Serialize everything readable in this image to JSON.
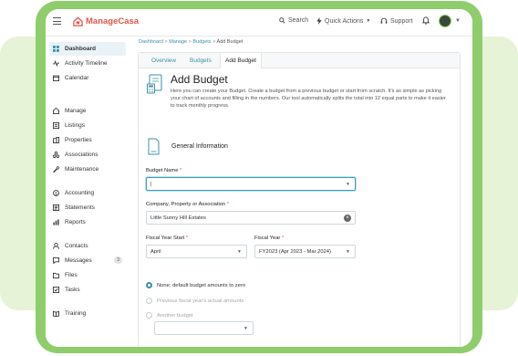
{
  "app": {
    "name": "ManageCasa"
  },
  "topbar": {
    "search_label": "Search",
    "quick_actions_label": "Quick Actions",
    "support_label": "Support"
  },
  "sidebar": {
    "items": [
      {
        "label": "Dashboard",
        "icon": "dashboard-icon",
        "active": true
      },
      {
        "label": "Activity Timeline",
        "icon": "activity-icon"
      },
      {
        "label": "Calendar",
        "icon": "calendar-icon"
      },
      {
        "label": "Manage",
        "icon": "manage-icon"
      },
      {
        "label": "Listings",
        "icon": "listings-icon"
      },
      {
        "label": "Properties",
        "icon": "properties-icon"
      },
      {
        "label": "Associations",
        "icon": "associations-icon"
      },
      {
        "label": "Maintenance",
        "icon": "maintenance-icon"
      },
      {
        "label": "Accounting",
        "icon": "accounting-icon"
      },
      {
        "label": "Statements",
        "icon": "statements-icon"
      },
      {
        "label": "Reports",
        "icon": "reports-icon"
      },
      {
        "label": "Contacts",
        "icon": "contacts-icon"
      },
      {
        "label": "Messages",
        "icon": "messages-icon",
        "badge": "3"
      },
      {
        "label": "Files",
        "icon": "files-icon"
      },
      {
        "label": "Tasks",
        "icon": "tasks-icon"
      },
      {
        "label": "Training",
        "icon": "training-icon"
      }
    ]
  },
  "breadcrumb": {
    "items": [
      "Dashboard",
      "Manage",
      "Budgets"
    ],
    "current": "Add Budget",
    "separator": ">"
  },
  "tabs": [
    "Overview",
    "Budgets",
    "Add Budget"
  ],
  "page": {
    "title": "Add Budget",
    "description": "Here you can create your Budget. Create a budget from a previous budget or start from scratch. It's as simple as picking your chart of accounts and filling in the numbers. Our tool automatically splits the total into 12 equal parts to make it easier to track monthly progress."
  },
  "form": {
    "section_title": "General Information",
    "budget_name_label": "Budget Name",
    "budget_name_value": "|",
    "company_label": "Company, Property or Association",
    "company_value": "Little Sunny Hill Estates",
    "fy_start_label": "Fiscal Year Start",
    "fy_start_value": "April",
    "fy_label": "Fiscal Year",
    "fy_value": "FY2023 (Apr 2023 - Mar 2024)",
    "required_mark": "*",
    "options": [
      {
        "label": "None; default budget amounts to zero",
        "selected": true,
        "disabled": false
      },
      {
        "label": "Previous fiscal year's actual amounts",
        "selected": false,
        "disabled": true
      },
      {
        "label": "Another budget",
        "selected": false,
        "disabled": true
      }
    ],
    "another_budget_value": ""
  },
  "colors": {
    "frame": "#8fcd6c",
    "brand": "#e2574c",
    "link": "#3b8fa8",
    "active_nav_bg": "#e9f2f6"
  }
}
